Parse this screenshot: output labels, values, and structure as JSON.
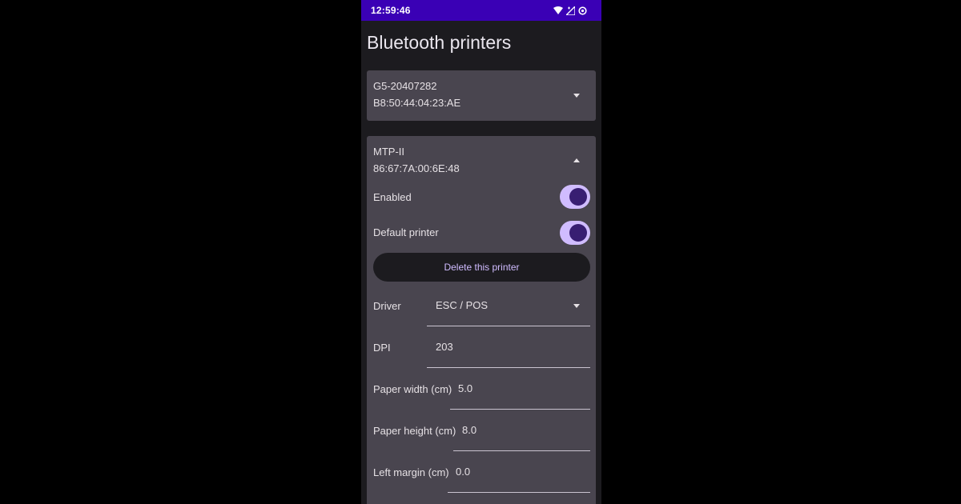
{
  "status": {
    "time": "12:59:46"
  },
  "page": {
    "title": "Bluetooth printers"
  },
  "printers": [
    {
      "name": "G5-20407282",
      "address": "B8:50:44:04:23:AE",
      "expanded": false
    },
    {
      "name": "MTP-II",
      "address": "86:67:7A:00:6E:48",
      "expanded": true
    }
  ],
  "settings": {
    "enabled_label": "Enabled",
    "enabled": true,
    "default_label": "Default printer",
    "default": true,
    "delete_label": "Delete this printer",
    "driver_label": "Driver",
    "driver_value": "ESC / POS",
    "dpi_label": "DPI",
    "dpi_value": "203",
    "paper_width_label": "Paper width (cm)",
    "paper_width_value": "5.0",
    "paper_height_label": "Paper height (cm)",
    "paper_height_value": "8.0",
    "left_margin_label": "Left margin (cm)",
    "left_margin_value": "0.0"
  },
  "colors": {
    "status_bar": "#3a00b5",
    "background": "#1c1b1f",
    "card": "#49454f",
    "accent": "#d0bcff",
    "toggle_knob": "#381e72"
  },
  "icons": [
    "wifi-icon",
    "signal-icon",
    "data-saver-icon",
    "chevron-down-icon",
    "chevron-up-icon"
  ]
}
